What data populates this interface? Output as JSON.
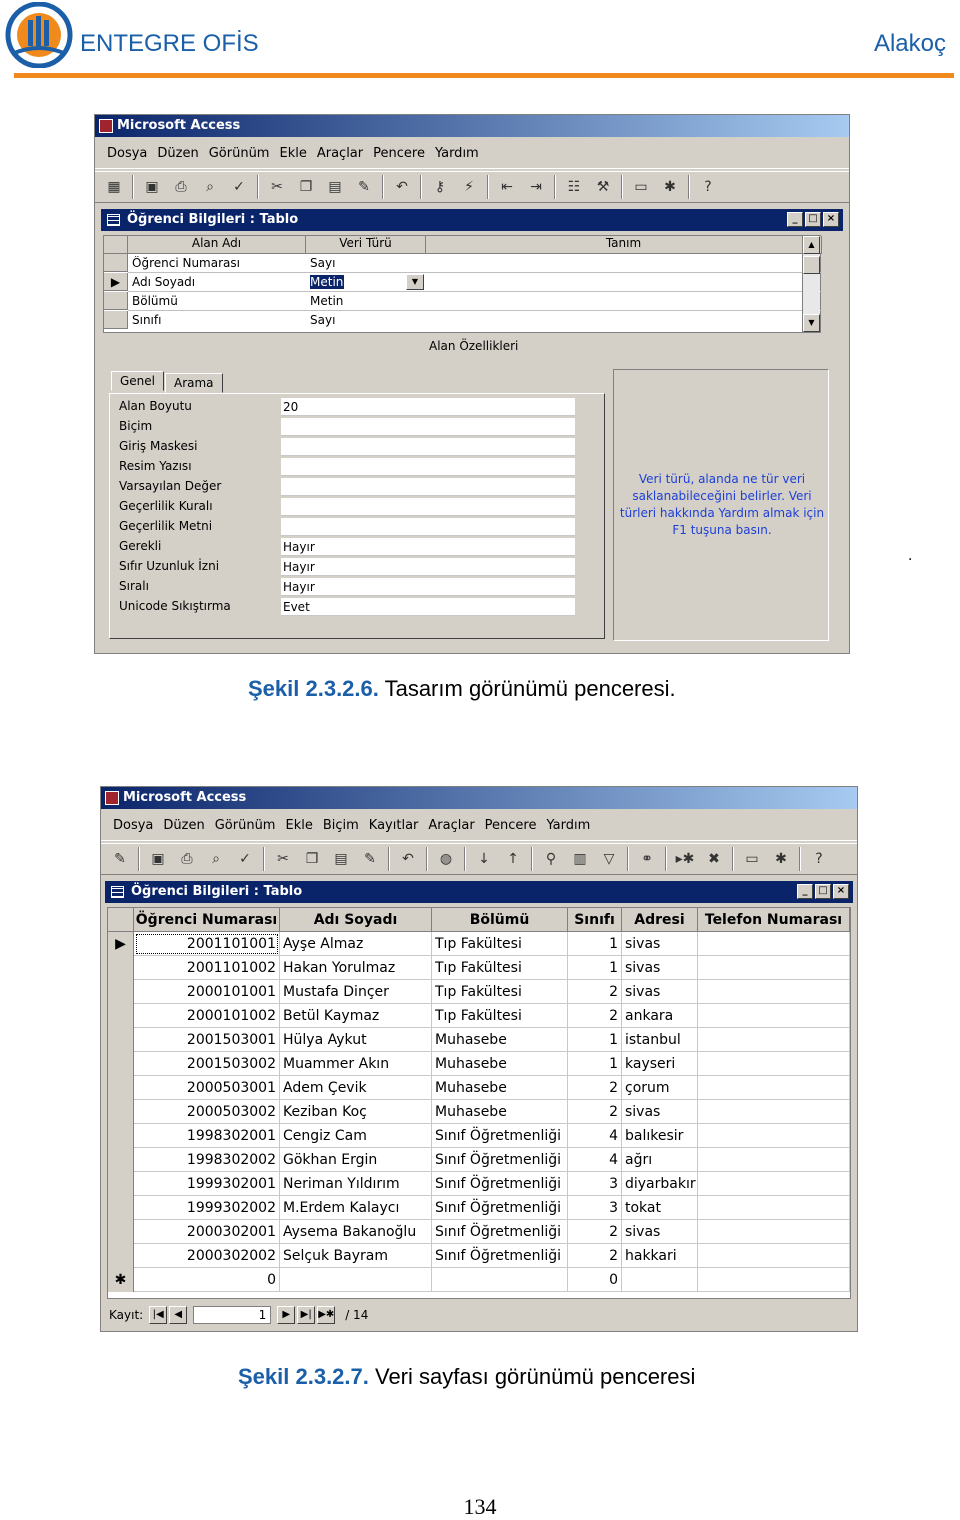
{
  "header": {
    "left": "ENTEGRE OFİS",
    "right": "Alakoç"
  },
  "window1": {
    "title": "Microsoft Access",
    "menu": [
      "Dosya",
      "Düzen",
      "Görünüm",
      "Ekle",
      "Araçlar",
      "Pencere",
      "Yardım"
    ],
    "child_title": "Öğrenci Bilgileri : Tablo",
    "grid_headers": {
      "field": "Alan Adı",
      "type": "Veri Türü",
      "desc": "Tanım"
    },
    "rows": [
      {
        "field": "Öğrenci Numarası",
        "type": "Sayı"
      },
      {
        "field": "Adı Soyadı",
        "type": "Metin"
      },
      {
        "field": "Bölümü",
        "type": "Metin"
      },
      {
        "field": "Sınıfı",
        "type": "Sayı"
      }
    ],
    "props_header": "Alan Özellikleri",
    "tabs": [
      "Genel",
      "Arama"
    ],
    "properties": [
      {
        "label": "Alan Boyutu",
        "value": "20"
      },
      {
        "label": "Biçim",
        "value": ""
      },
      {
        "label": "Giriş Maskesi",
        "value": ""
      },
      {
        "label": "Resim Yazısı",
        "value": ""
      },
      {
        "label": "Varsayılan Değer",
        "value": ""
      },
      {
        "label": "Geçerlilik Kuralı",
        "value": ""
      },
      {
        "label": "Geçerlilik Metni",
        "value": ""
      },
      {
        "label": "Gerekli",
        "value": "Hayır"
      },
      {
        "label": "Sıfır Uzunluk İzni",
        "value": "Hayır"
      },
      {
        "label": "Sıralı",
        "value": "Hayır"
      },
      {
        "label": "Unicode Sıkıştırma",
        "value": "Evet"
      }
    ],
    "help": [
      "Veri türü, alanda ne tür veri",
      "saklanabileceğini belirler. Veri",
      "türleri hakkında Yardım almak için",
      "F1 tuşuna basın."
    ]
  },
  "caption1": {
    "num": "Şekil 2.3.2.6.",
    "text": " Tasarım görünümü penceresi."
  },
  "window2": {
    "title": "Microsoft Access",
    "menu": [
      "Dosya",
      "Düzen",
      "Görünüm",
      "Ekle",
      "Biçim",
      "Kayıtlar",
      "Araçlar",
      "Pencere",
      "Yardım"
    ],
    "child_title": "Öğrenci Bilgileri : Tablo",
    "columns": [
      "Öğrenci Numarası",
      "Adı Soyadı",
      "Bölümü",
      "Sınıfı",
      "Adresi",
      "Telefon Numarası"
    ],
    "records": [
      [
        "2001101001",
        "Ayşe Almaz",
        "Tıp Fakültesi",
        "1",
        "sivas",
        ""
      ],
      [
        "2001101002",
        "Hakan Yorulmaz",
        "Tıp Fakültesi",
        "1",
        "sivas",
        ""
      ],
      [
        "2000101001",
        "Mustafa Dinçer",
        "Tıp Fakültesi",
        "2",
        "sivas",
        ""
      ],
      [
        "2000101002",
        "Betül Kaymaz",
        "Tıp Fakültesi",
        "2",
        "ankara",
        ""
      ],
      [
        "2001503001",
        "Hülya Aykut",
        "Muhasebe",
        "1",
        "istanbul",
        ""
      ],
      [
        "2001503002",
        "Muammer Akın",
        "Muhasebe",
        "1",
        "kayseri",
        ""
      ],
      [
        "2000503001",
        "Adem Çevik",
        "Muhasebe",
        "2",
        "çorum",
        ""
      ],
      [
        "2000503002",
        "Keziban Koç",
        "Muhasebe",
        "2",
        "sivas",
        ""
      ],
      [
        "1998302001",
        "Cengiz Cam",
        "Sınıf Öğretmenliği",
        "4",
        "balıkesir",
        ""
      ],
      [
        "1998302002",
        "Gökhan Ergin",
        "Sınıf Öğretmenliği",
        "4",
        "ağrı",
        ""
      ],
      [
        "1999302001",
        "Neriman Yıldırım",
        "Sınıf Öğretmenliği",
        "3",
        "diyarbakır",
        ""
      ],
      [
        "1999302002",
        "M.Erdem Kalaycı",
        "Sınıf Öğretmenliği",
        "3",
        "tokat",
        ""
      ],
      [
        "2000302001",
        "Aysema Bakanoğlu",
        "Sınıf Öğretmenliği",
        "2",
        "sivas",
        ""
      ],
      [
        "2000302002",
        "Selçuk Bayram",
        "Sınıf Öğretmenliği",
        "2",
        "hakkari",
        ""
      ],
      [
        "0",
        "",
        "",
        "0",
        "",
        ""
      ]
    ],
    "nav": {
      "label": "Kayıt:",
      "current": "1",
      "total": "/ 14"
    }
  },
  "caption2": {
    "num": "Şekil 2.3.2.7.",
    "text": " Veri sayfası görünümü penceresi"
  },
  "page_number": "134",
  "stray_mark": "."
}
